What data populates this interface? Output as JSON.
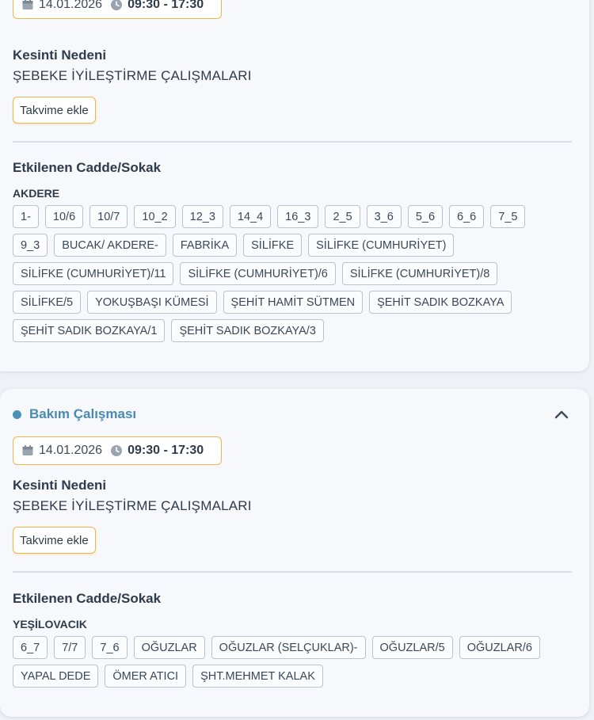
{
  "colors": {
    "accent_orange": "#f0b54a",
    "type_blue": "#4a8ab0",
    "tag_border": "#b8c3cf"
  },
  "cards": [
    {
      "date": "14.01.2026",
      "time": "09:30 - 17:30",
      "reason_label": "Kesinti Nedeni",
      "reason_value": "ŞEBEKE İYİLEŞTİRME ÇALIŞMALARI",
      "calendar_button": "Takvime ekle",
      "streets_heading": "Etkilenen Cadde/Sokak",
      "region": "AKDERE",
      "streets": [
        "1-",
        "10/6",
        "10/7",
        "10_2",
        "12_3",
        "14_4",
        "16_3",
        "2_5",
        "3_6",
        "5_6",
        "6_6",
        "7_5",
        "9_3",
        "BUCAK/ AKDERE-",
        "FABRİKA",
        "SİLİFKE",
        "SİLİFKE (CUMHURİYET)",
        "SİLİFKE (CUMHURİYET)/11",
        "SİLİFKE (CUMHURİYET)/6",
        "SİLİFKE (CUMHURİYET)/8",
        "SİLİFKE/5",
        "YOKUŞBAŞI KÜMESİ",
        "ŞEHİT HAMİT SÜTMEN",
        "ŞEHİT SADIK BOZKAYA",
        "ŞEHİT SADIK BOZKAYA/1",
        "ŞEHİT SADIK BOZKAYA/3"
      ]
    },
    {
      "type": "Bakım Çalışması",
      "date": "14.01.2026",
      "time": "09:30 - 17:30",
      "reason_label": "Kesinti Nedeni",
      "reason_value": "ŞEBEKE İYİLEŞTİRME ÇALIŞMALARI",
      "calendar_button": "Takvime ekle",
      "streets_heading": "Etkilenen Cadde/Sokak",
      "region": "YEŞİLOVACIK",
      "streets": [
        "6_7",
        "7/7",
        "7_6",
        "OĞUZLAR",
        "OĞUZLAR (SELÇUKLAR)-",
        "OĞUZLAR/5",
        "OĞUZLAR/6",
        "YAPAL DEDE",
        "ÖMER ATICI",
        "ŞHT.MEHMET KALAK"
      ]
    }
  ]
}
